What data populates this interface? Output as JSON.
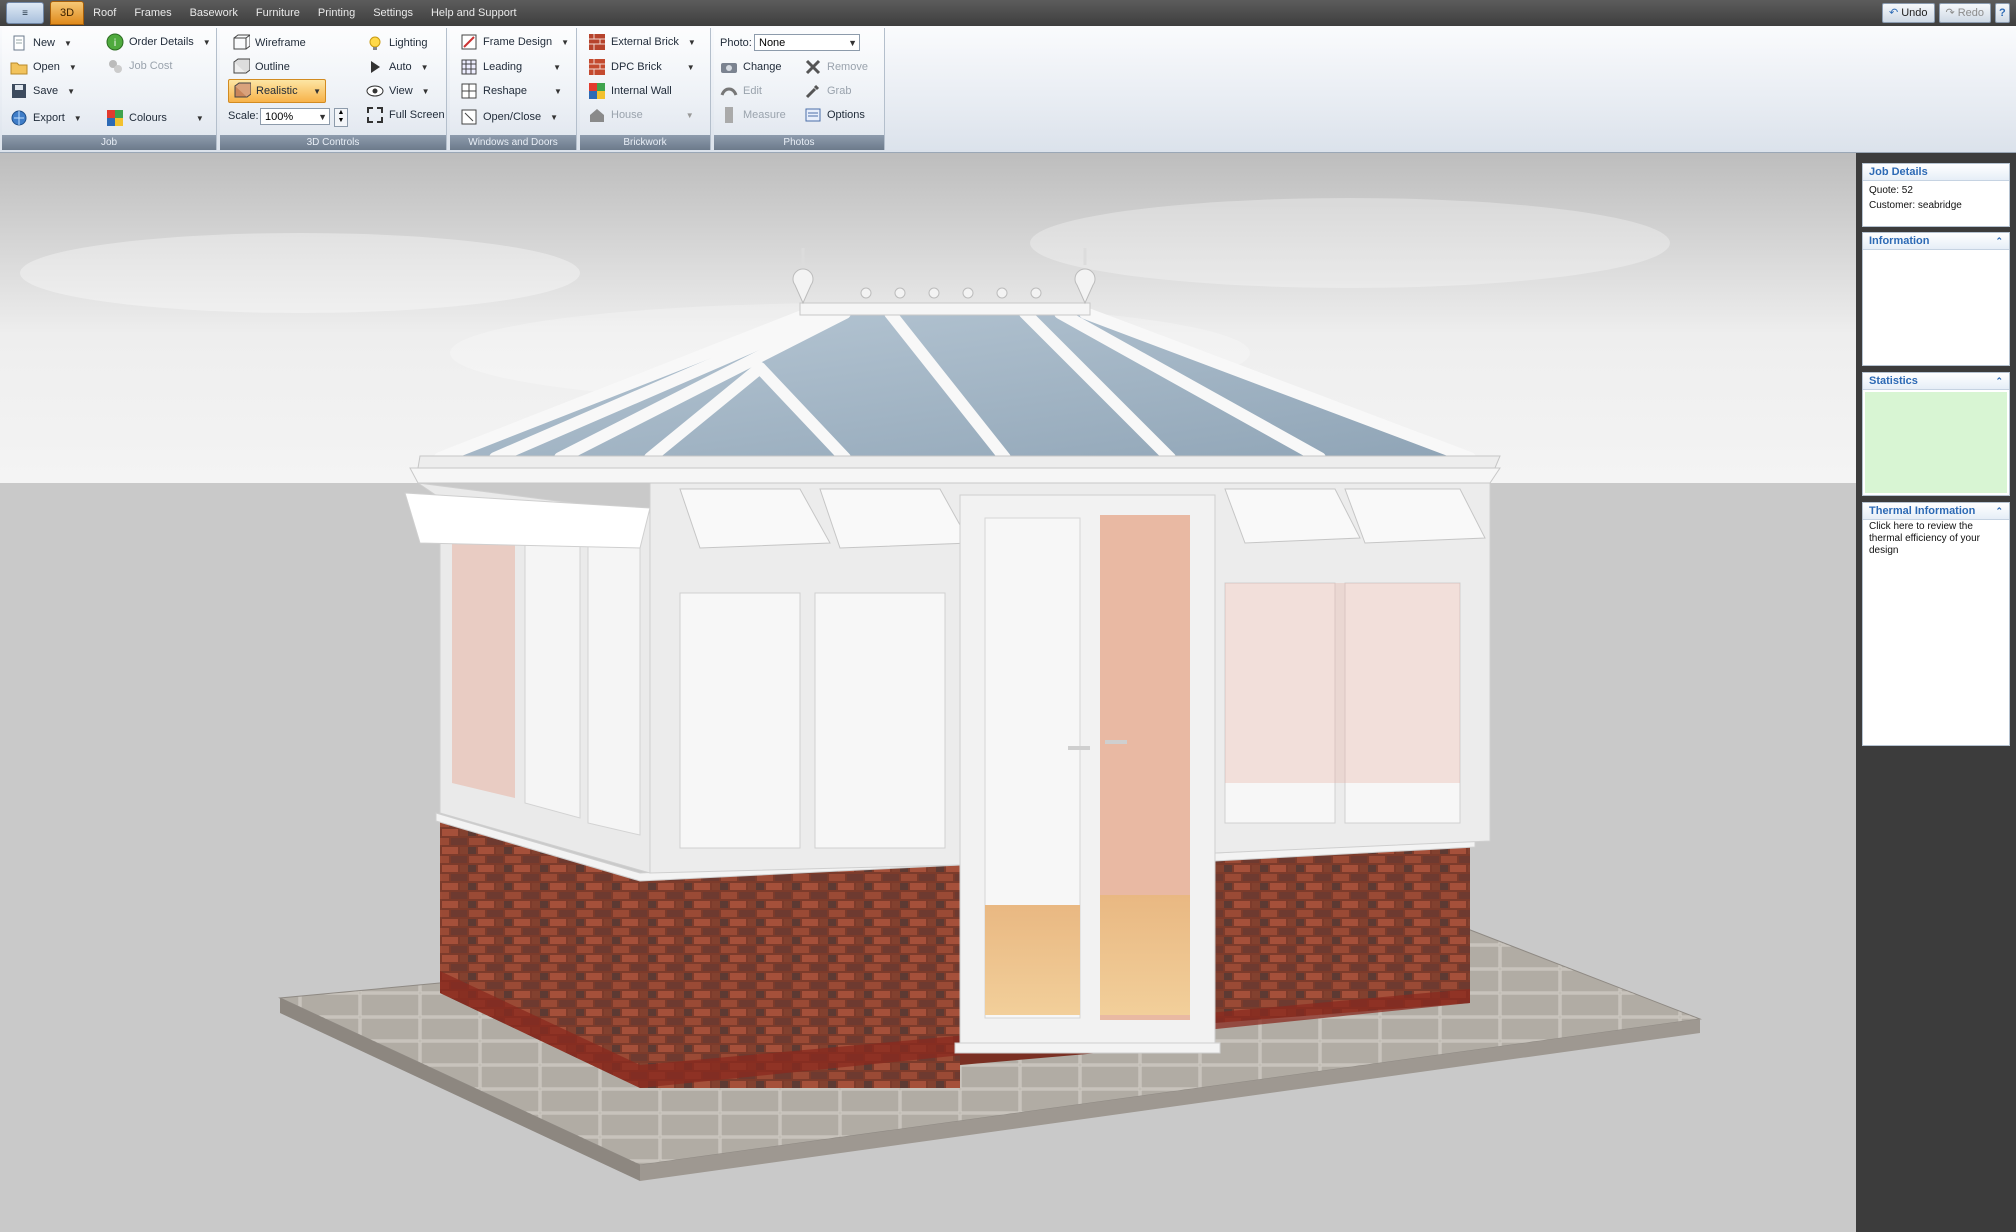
{
  "menubar": {
    "app_button": "≡",
    "tabs": [
      "3D",
      "Roof",
      "Frames",
      "Basework",
      "Furniture",
      "Printing",
      "Settings",
      "Help and Support"
    ],
    "active_tab": "3D",
    "undo": "Undo",
    "redo": "Redo"
  },
  "ribbon": {
    "job": {
      "label": "Job",
      "new": "New",
      "open": "Open",
      "save": "Save",
      "export": "Export",
      "order_details": "Order Details",
      "job_cost": "Job Cost",
      "colours": "Colours"
    },
    "controls": {
      "label": "3D Controls",
      "wireframe": "Wireframe",
      "outline": "Outline",
      "realistic": "Realistic",
      "scale_label": "Scale:",
      "scale_value": "100%",
      "lighting": "Lighting",
      "auto": "Auto",
      "view": "View",
      "full_screen": "Full Screen"
    },
    "windows": {
      "label": "Windows and Doors",
      "frame_design": "Frame Design",
      "leading": "Leading",
      "reshape": "Reshape",
      "open_close": "Open/Close"
    },
    "brickwork": {
      "label": "Brickwork",
      "external_brick": "External Brick",
      "dpc_brick": "DPC Brick",
      "internal_wall": "Internal Wall",
      "house": "House"
    },
    "photos": {
      "label": "Photos",
      "photo_label": "Photo:",
      "photo_value": "None",
      "change": "Change",
      "edit": "Edit",
      "measure": "Measure",
      "remove": "Remove",
      "grab": "Grab",
      "options": "Options"
    }
  },
  "panel": {
    "job_details": {
      "title": "Job Details",
      "quote": "Quote: 52",
      "customer": "Customer: seabridge"
    },
    "information": {
      "title": "Information"
    },
    "statistics": {
      "title": "Statistics"
    },
    "thermal": {
      "title": "Thermal Information",
      "text": "Click here to review the thermal efficiency of your design"
    }
  },
  "colors": {
    "accent_tab": "#e08a1c",
    "panel_link": "#2d6ab5",
    "statistics_bg": "#d8f5d3",
    "brick": "#8a3e2c",
    "paving": "#b3aea6",
    "glass": "#9fb5c8"
  }
}
